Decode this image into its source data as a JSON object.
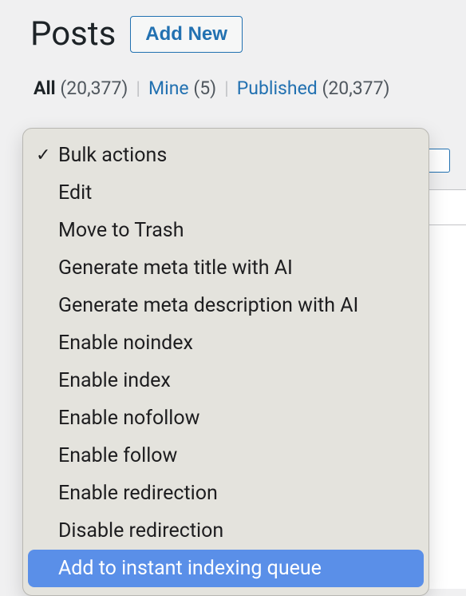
{
  "header": {
    "title": "Posts",
    "add_new_label": "Add New"
  },
  "filters": {
    "all_label": "All",
    "all_count": "(20,377)",
    "mine_label": "Mine",
    "mine_count": "(5)",
    "published_label": "Published",
    "published_count": "(20,377)",
    "divider": "|"
  },
  "bulk_actions": {
    "selected_index": 0,
    "highlighted_index": 11,
    "items": [
      {
        "label": "Bulk actions",
        "checked": true
      },
      {
        "label": "Edit",
        "checked": false
      },
      {
        "label": "Move to Trash",
        "checked": false
      },
      {
        "label": "Generate meta title with AI",
        "checked": false
      },
      {
        "label": "Generate meta description with AI",
        "checked": false
      },
      {
        "label": "Enable noindex",
        "checked": false
      },
      {
        "label": "Enable index",
        "checked": false
      },
      {
        "label": "Enable nofollow",
        "checked": false
      },
      {
        "label": "Enable follow",
        "checked": false
      },
      {
        "label": "Enable redirection",
        "checked": false
      },
      {
        "label": "Disable redirection",
        "checked": false
      },
      {
        "label": "Add to instant indexing queue",
        "checked": false
      }
    ]
  }
}
